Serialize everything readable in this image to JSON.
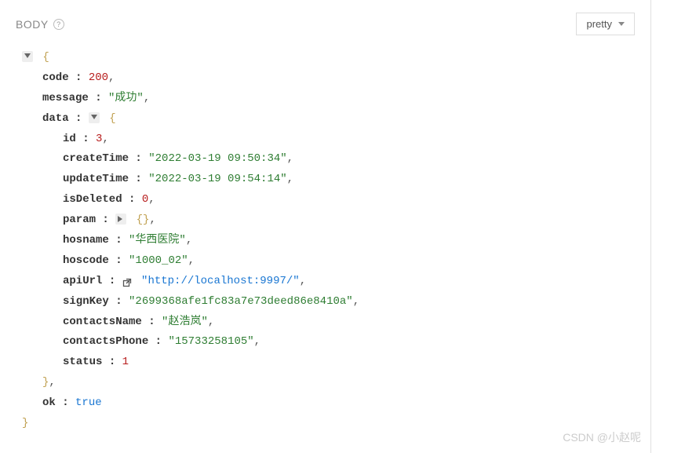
{
  "header": {
    "body_label": "BODY",
    "help_tooltip": "?",
    "pretty_label": "pretty"
  },
  "json": {
    "open_brace": "{",
    "close_brace": "}",
    "open_brace_empty": "{}",
    "keys": {
      "code": "code",
      "message": "message",
      "data": "data",
      "id": "id",
      "createTime": "createTime",
      "updateTime": "updateTime",
      "isDeleted": "isDeleted",
      "param": "param",
      "hosname": "hosname",
      "hoscode": "hoscode",
      "apiUrl": "apiUrl",
      "signKey": "signKey",
      "contactsName": "contactsName",
      "contactsPhone": "contactsPhone",
      "status": "status",
      "ok": "ok"
    },
    "values": {
      "code": "200",
      "message": "\"成功\"",
      "id": "3",
      "createTime": "\"2022-03-19 09:50:34\"",
      "updateTime": "\"2022-03-19 09:54:14\"",
      "isDeleted": "0",
      "hosname": "\"华西医院\"",
      "hoscode": "\"1000_02\"",
      "apiUrl": "\"http://localhost:9997/\"",
      "signKey": "\"2699368afe1fc83a7e73deed86e8410a\"",
      "contactsName": "\"赵浩岚\"",
      "contactsPhone": "\"15733258105\"",
      "status": "1",
      "ok": "true"
    }
  },
  "watermark": "CSDN @小赵呢"
}
